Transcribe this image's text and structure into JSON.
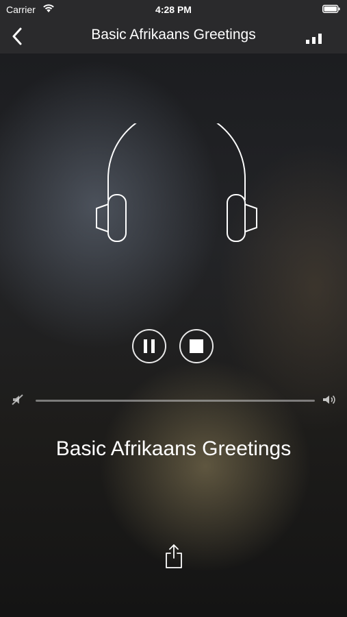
{
  "status_bar": {
    "carrier": "Carrier",
    "time": "4:28 PM"
  },
  "nav": {
    "title": "Basic Afrikaans Greetings",
    "back_icon": "chevron-left-icon",
    "right_icon": "signal-bars-icon"
  },
  "player": {
    "artwork_icon": "headphones-icon",
    "controls": [
      "pause",
      "stop"
    ],
    "volume_level": 1.0,
    "track_title": "Basic Afrikaans Greetings",
    "share_icon": "share-icon"
  },
  "colors": {
    "bar_background": "#2a2a2c",
    "foreground": "#ffffff"
  }
}
